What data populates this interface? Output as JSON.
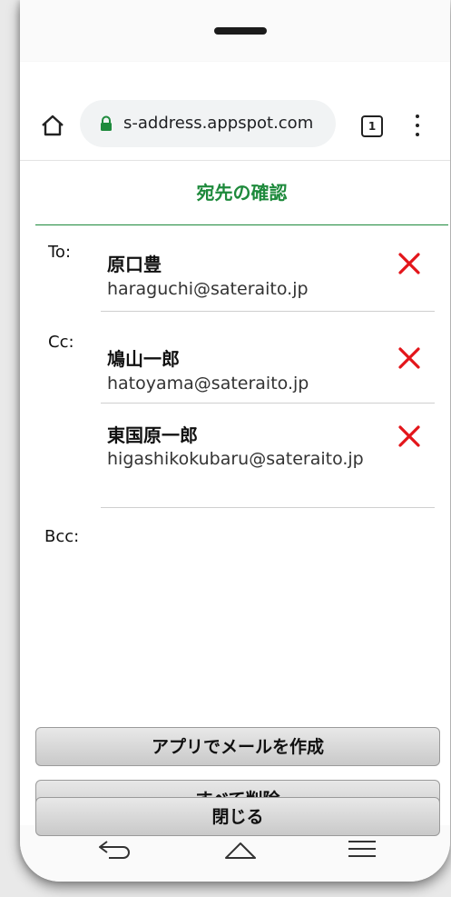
{
  "browser": {
    "url": "s-address.appspot.com",
    "tab_count": "1"
  },
  "page": {
    "title": "宛先の確認"
  },
  "recipients": {
    "to_label": "To:",
    "cc_label": "Cc:",
    "bcc_label": "Bcc:",
    "to": [
      {
        "name": "原口豊",
        "email": "haraguchi@sateraito.jp"
      }
    ],
    "cc": [
      {
        "name": "鳩山一郎",
        "email": "hatoyama@sateraito.jp"
      },
      {
        "name": "東国原一郎",
        "email": "higashikokubaru@sateraito.jp"
      }
    ]
  },
  "actions": {
    "compose_label": "アプリでメールを作成",
    "delete_all_label": "すべて削除",
    "close_label": "閉じる"
  },
  "colors": {
    "accent": "#1e8a3c",
    "delete": "#e3151a"
  },
  "icons": {
    "home": "home-icon",
    "lock": "lock-icon",
    "menu": "more-vert-icon",
    "remove": "close-x-icon",
    "back": "back-icon",
    "nav_home": "nav-home-icon",
    "recents": "recents-menu-icon"
  }
}
